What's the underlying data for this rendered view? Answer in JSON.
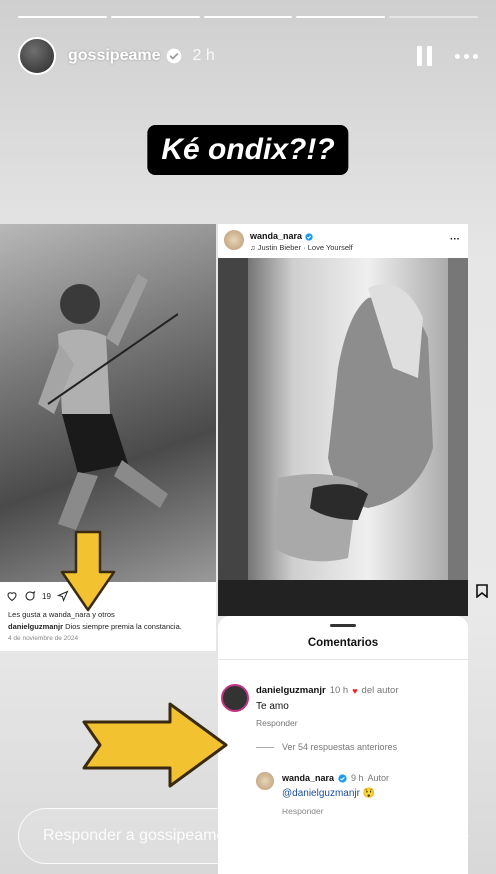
{
  "story": {
    "progress_segments": 5,
    "progress_done": 4,
    "username": "gossipeame",
    "time": "2 h",
    "caption": "Ké ondix?!?"
  },
  "left_post": {
    "likes_count": "19",
    "likes_text": "Les gusta a wanda_nara y otros",
    "caption_user": "danielguzmanjr",
    "caption_text": "Dios siempre premia la constancia.",
    "date": "4 de noviembre de 2024"
  },
  "right_post": {
    "username": "wanda_nara",
    "song": "♫ Justin Bieber · Love Yourself",
    "more": "···"
  },
  "comments": {
    "title": "Comentarios",
    "c1": {
      "user": "danielguzmanjr",
      "time": "10 h",
      "author_tag": "del autor",
      "text": "Te amo",
      "reply": "Responder"
    },
    "view_previous": "Ver 54 respuestas anteriores",
    "c2": {
      "user": "wanda_nara",
      "time": "9 h",
      "author_tag": "Autor",
      "text": "@danielguzmanjr 😲",
      "reply": "Responder"
    }
  },
  "reply_bar": {
    "placeholder": "Responder a gossipeame..."
  },
  "colors": {
    "accent_yellow": "#f2c230",
    "verified_blue": "#1d9bf0",
    "heart_red": "#ed1c24"
  }
}
